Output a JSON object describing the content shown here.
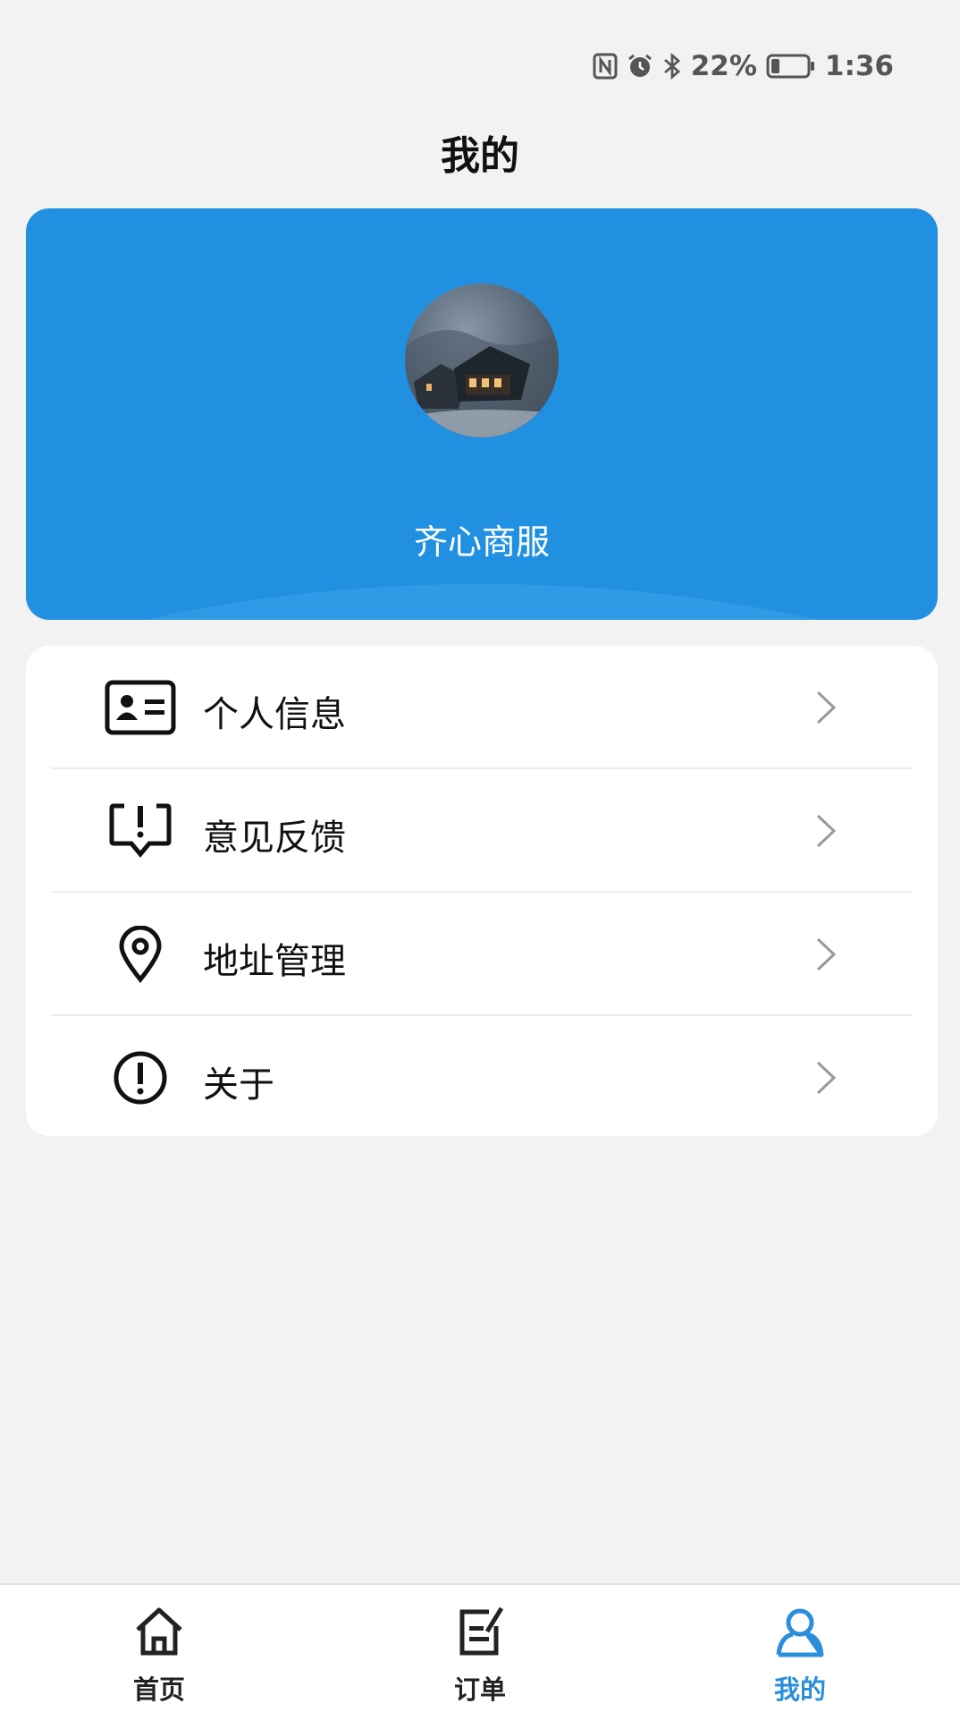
{
  "status_bar": {
    "battery_percent": "22%",
    "time": "1:36",
    "icons": [
      "nfc-icon",
      "alarm-icon",
      "bluetooth-icon",
      "battery-icon"
    ]
  },
  "page": {
    "title": "我的"
  },
  "profile": {
    "name": "齐心商服",
    "card_color": "#2190e0"
  },
  "menu": {
    "items": [
      {
        "label": "个人信息",
        "icon": "id-card-icon"
      },
      {
        "label": "意见反馈",
        "icon": "feedback-icon"
      },
      {
        "label": "地址管理",
        "icon": "location-pin-icon"
      },
      {
        "label": "关于",
        "icon": "info-alert-icon"
      }
    ]
  },
  "bottom_nav": {
    "active_color": "#2a8fdb",
    "items": [
      {
        "label": "首页",
        "icon": "home-icon",
        "active": false
      },
      {
        "label": "订单",
        "icon": "order-icon",
        "active": false
      },
      {
        "label": "我的",
        "icon": "user-icon",
        "active": true
      }
    ]
  }
}
